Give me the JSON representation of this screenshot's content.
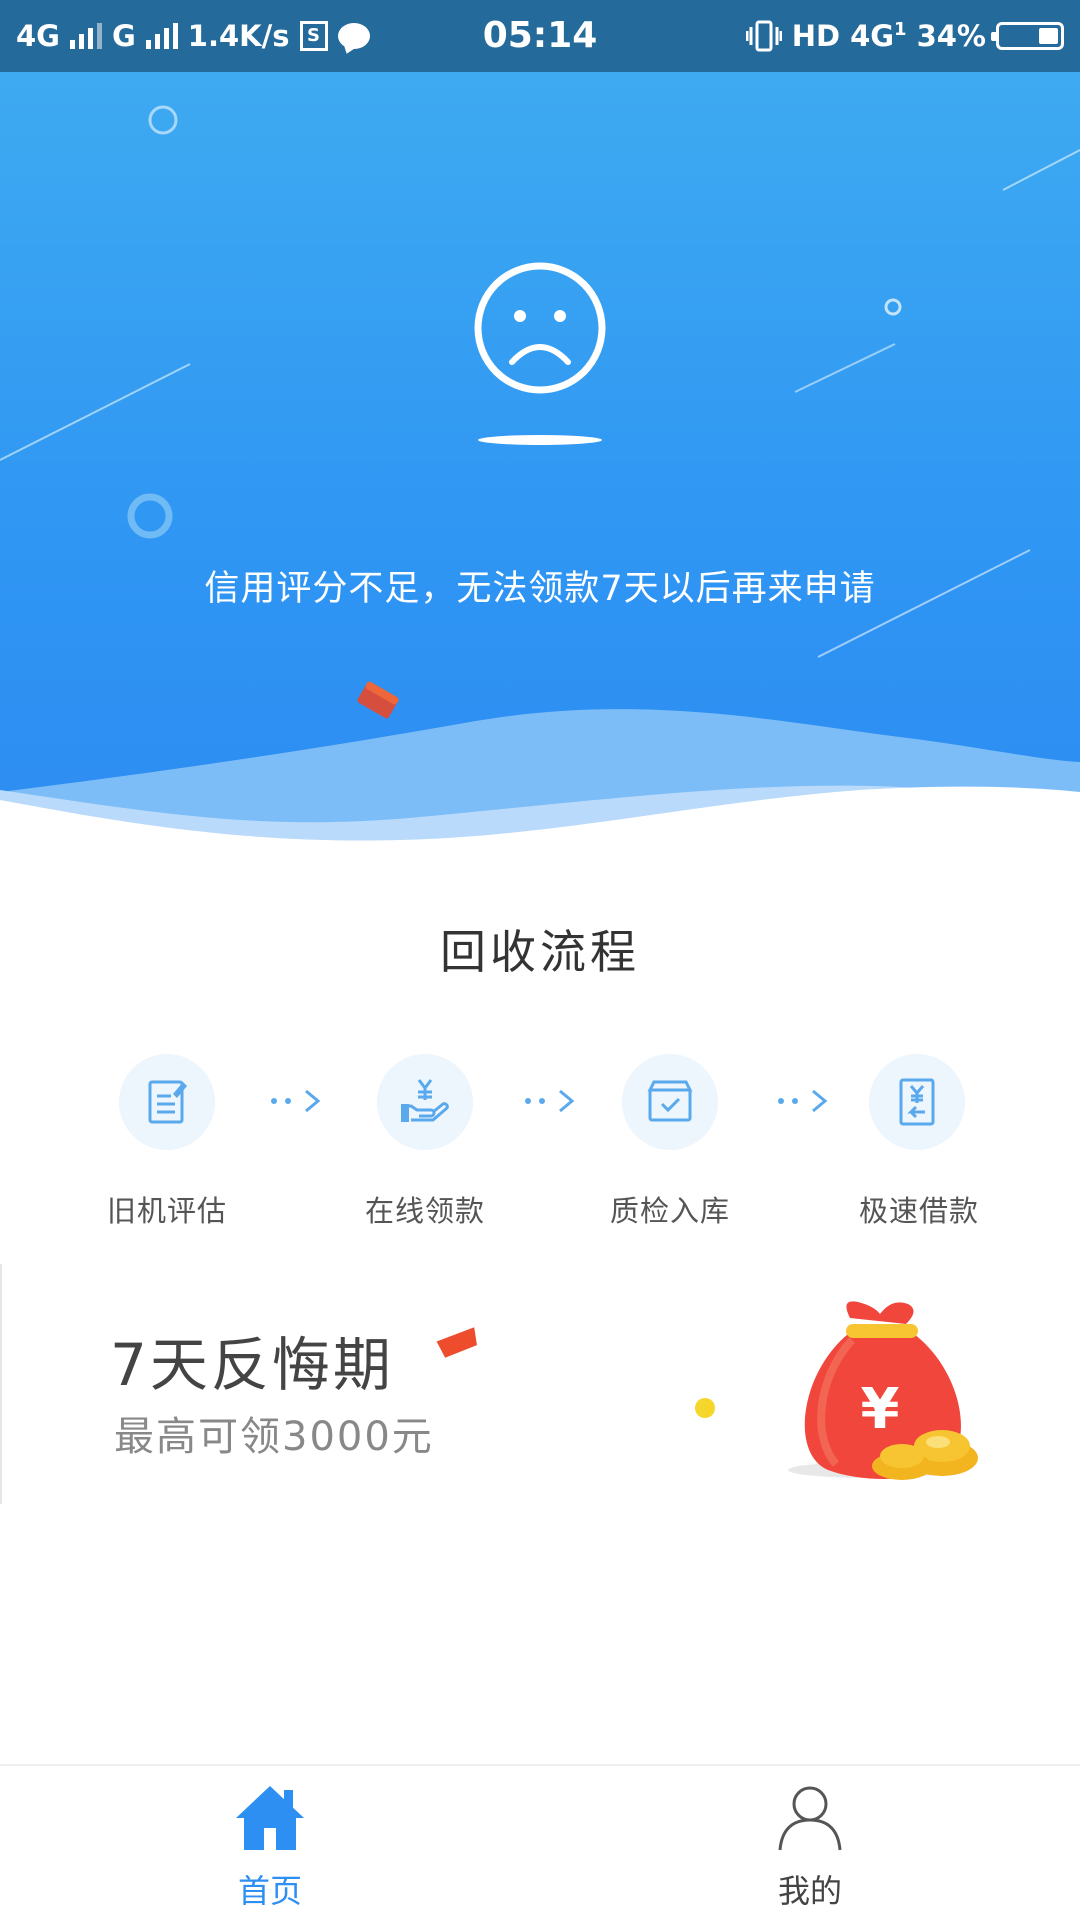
{
  "status_bar": {
    "network1": "4G",
    "network2": "G",
    "speed": "1.4K/s",
    "s_label": "S",
    "time": "05:14",
    "hd": "HD",
    "network3": "4G",
    "sim": "1",
    "battery": "34%",
    "battery_level": 0.34
  },
  "hero": {
    "notice": "信用评分不足，无法领款7天以后再来申请",
    "face_icon": "sad-face-icon"
  },
  "process": {
    "title": "回收流程",
    "steps": [
      {
        "label": "旧机评估",
        "icon": "document-edit-icon"
      },
      {
        "label": "在线领款",
        "icon": "hand-money-icon"
      },
      {
        "label": "质检入库",
        "icon": "box-check-icon"
      },
      {
        "label": "极速借款",
        "icon": "yuan-return-icon"
      }
    ]
  },
  "promo": {
    "title": "7天反悔期",
    "subtitle": "最高可领3000元",
    "bag_symbol": "¥",
    "icon": "money-bag-icon"
  },
  "nav": {
    "items": [
      {
        "label": "首页",
        "icon": "home-icon",
        "active": true
      },
      {
        "label": "我的",
        "icon": "user-icon",
        "active": false
      }
    ]
  },
  "colors": {
    "primary": "#2e8ff2",
    "status_bar": "#246a9b",
    "hero_top": "#3eaaf1",
    "hero_bottom": "#2d8cf2",
    "step_bg": "#edf5fd",
    "bag_red": "#f0463c",
    "gold": "#f7c531"
  }
}
